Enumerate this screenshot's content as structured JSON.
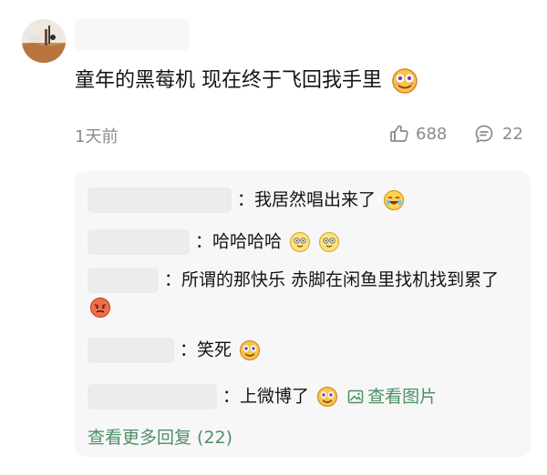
{
  "comment": {
    "text": "童年的黑莓机 现在终于飞回我手里",
    "time": "1天前",
    "likes": "688",
    "comments": "22",
    "emoji": "dizzy-face"
  },
  "replies": [
    {
      "text": "：我居然唱出来了",
      "emoji": "laugh-cry"
    },
    {
      "text": "：哈哈哈哈",
      "emoji": "giggle-faces"
    },
    {
      "text": "：所谓的那快乐 赤脚在闲鱼里找机找到累了",
      "emoji": "angry-face"
    },
    {
      "text": "：笑死",
      "emoji": "dizzy-face"
    },
    {
      "text": "：上微博了",
      "emoji": "dizzy-face",
      "link": "查看图片"
    }
  ],
  "more_replies": "查看更多回复 (22)",
  "colors": {
    "accent_green": "#4f8f63",
    "meta_gray": "#8a8a8f",
    "panel_bg": "#f7f7f8"
  }
}
